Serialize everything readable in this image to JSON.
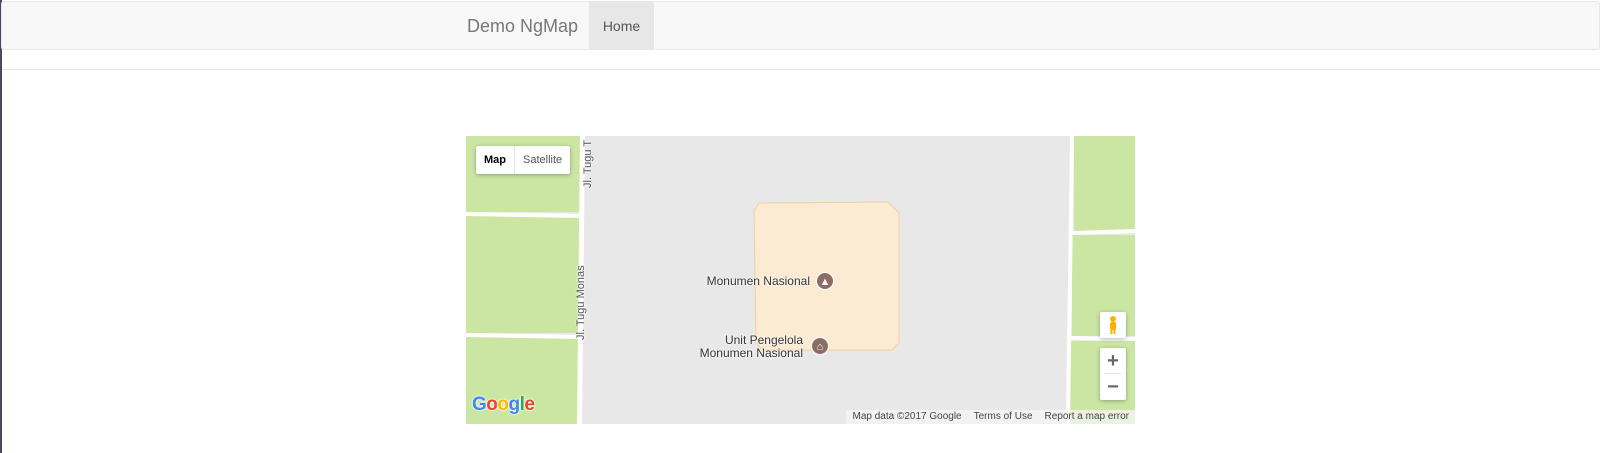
{
  "navbar": {
    "brand": "Demo NgMap",
    "items": [
      {
        "label": "Home",
        "active": true
      }
    ]
  },
  "map": {
    "type_control": {
      "map_label": "Map",
      "satellite_label": "Satellite",
      "selected": "Map"
    },
    "roads": [
      {
        "name": "Jl. Tugu Monas"
      },
      {
        "name": "Jl. Tugu T"
      }
    ],
    "pois": [
      {
        "name": "Monumen Nasional",
        "icon": "monument-icon"
      },
      {
        "name": "Unit Pengelola\nMonumen Nasional",
        "icon": "museum-icon"
      }
    ],
    "zoom_in_label": "+",
    "zoom_out_label": "−",
    "logo": "Google",
    "footer": {
      "data": "Map data ©2017 Google",
      "terms": "Terms of Use",
      "report": "Report a map error"
    },
    "colors": {
      "park": "#cae6a2",
      "plaza": "#fbebd2",
      "ground": "#e8e8e8",
      "road": "#ffffff",
      "poi": "#8c6d62"
    }
  }
}
